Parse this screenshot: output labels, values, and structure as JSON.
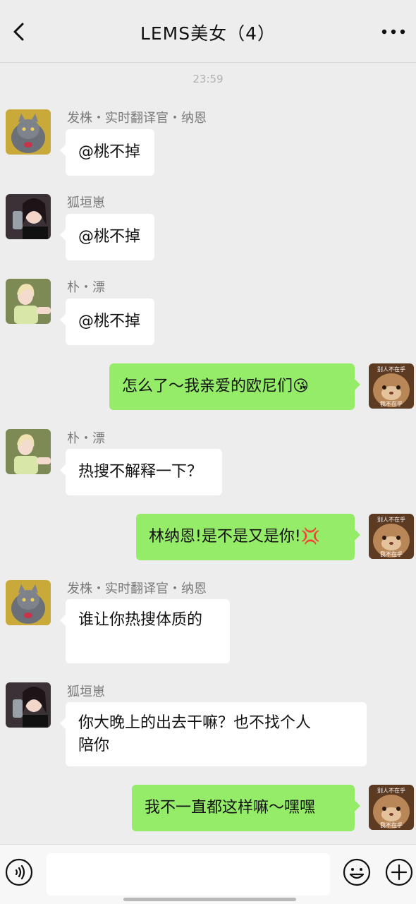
{
  "header": {
    "title": "LEMS美女（4）"
  },
  "timestamp": "23:59",
  "messages": [
    {
      "sender": "发株・实时翻译官・纳恩",
      "text": "@桃不掉",
      "direction": "in",
      "avatar": "cat-avatar"
    },
    {
      "sender": "狐垣崽",
      "text": "@桃不掉",
      "direction": "in",
      "avatar": "girl-selfie-avatar"
    },
    {
      "sender": "朴・漂",
      "text": "@桃不掉",
      "direction": "in",
      "avatar": "blonde-girl-avatar"
    },
    {
      "text": "怎么了～我亲爱的欧尼们",
      "emoji": "😘",
      "direction": "out",
      "avatar": "cat-meme-avatar"
    },
    {
      "sender": "朴・漂",
      "text": "热搜不解释一下？",
      "direction": "in",
      "avatar": "blonde-girl-avatar"
    },
    {
      "text": "林纳恩!是不是又是你!",
      "emoji": "💢",
      "direction": "out",
      "avatar": "cat-meme-avatar"
    },
    {
      "sender": "发株・实时翻译官・纳恩",
      "text": "谁让你热搜体质的",
      "direction": "in",
      "avatar": "cat-avatar"
    },
    {
      "sender": "狐垣崽",
      "text_line1": "你大晚上的出去干嘛？也不找个人",
      "text_line2": "陪你",
      "direction": "in",
      "avatar": "girl-selfie-avatar"
    },
    {
      "text": "我不一直都这样嘛～嘿嘿",
      "direction": "out",
      "avatar": "cat-meme-avatar"
    }
  ],
  "meme": {
    "top_caption": "别人不在乎",
    "bottom_caption": "我不在乎"
  },
  "input": {
    "value": ""
  },
  "colors": {
    "background": "#ededed",
    "outgoing_bubble": "#95ec69",
    "incoming_bubble": "#ffffff"
  }
}
